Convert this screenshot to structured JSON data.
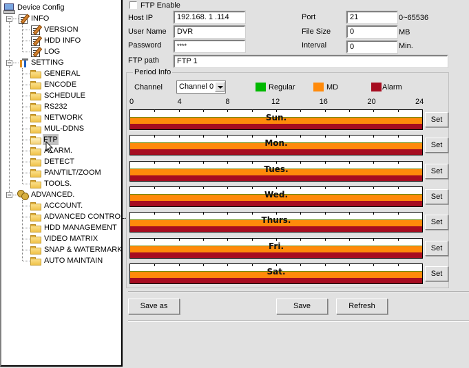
{
  "tree": {
    "root": {
      "label": "Device Config",
      "icon": "computer-icon"
    },
    "groups": [
      {
        "label": "INFO",
        "icon": "document-edit-icon",
        "expanded": true,
        "items": [
          {
            "label": "VERSION",
            "icon": "document-edit-icon"
          },
          {
            "label": "HDD INFO",
            "icon": "document-edit-icon"
          },
          {
            "label": "LOG",
            "icon": "document-edit-icon"
          }
        ]
      },
      {
        "label": "SETTING",
        "icon": "tools-icon",
        "expanded": true,
        "items": [
          {
            "label": "GENERAL",
            "icon": "folder-icon"
          },
          {
            "label": "ENCODE",
            "icon": "folder-icon"
          },
          {
            "label": "SCHEDULE",
            "icon": "folder-icon"
          },
          {
            "label": "RS232",
            "icon": "folder-icon"
          },
          {
            "label": "NETWORK",
            "icon": "folder-icon"
          },
          {
            "label": "MUL-DDNS",
            "icon": "folder-icon"
          },
          {
            "label": "FTP",
            "icon": "folder-open-icon",
            "selected": true
          },
          {
            "label": "ALARM.",
            "icon": "folder-icon"
          },
          {
            "label": "DETECT",
            "icon": "folder-icon"
          },
          {
            "label": "PAN/TILT/ZOOM",
            "icon": "folder-icon"
          },
          {
            "label": "TOOLS.",
            "icon": "folder-icon"
          }
        ]
      },
      {
        "label": "ADVANCED.",
        "icon": "gears-icon",
        "expanded": true,
        "items": [
          {
            "label": "ACCOUNT.",
            "icon": "folder-icon"
          },
          {
            "label": "ADVANCED CONTROL.",
            "icon": "folder-icon"
          },
          {
            "label": "HDD MANAGEMENT",
            "icon": "folder-icon"
          },
          {
            "label": "VIDEO MATRIX",
            "icon": "folder-icon"
          },
          {
            "label": "SNAP & WATERMARK",
            "icon": "folder-icon"
          },
          {
            "label": "AUTO MAINTAIN",
            "icon": "folder-icon"
          }
        ]
      }
    ]
  },
  "ftp": {
    "enable_label": "FTP Enable",
    "enable_checked": false,
    "host_ip_label": "Host IP",
    "host_ip_value": "192.168.  1 .114",
    "user_name_label": "User Name",
    "user_name_value": "DVR",
    "password_label": "Password",
    "password_value": "****",
    "ftp_path_label": "FTP path",
    "ftp_path_value": "FTP 1",
    "port_label": "Port",
    "port_value": "21",
    "port_range": "0~65536",
    "file_size_label": "File Size",
    "file_size_value": "0",
    "file_size_unit": "MB",
    "interval_label": "Interval",
    "interval_value": "0",
    "interval_unit": "Min."
  },
  "period": {
    "title": "Period Info",
    "channel_label": "Channel",
    "channel_selected": "Channel  0",
    "legend": [
      {
        "label": "Regular",
        "color": "#00b800"
      },
      {
        "label": "MD",
        "color": "#ff8a0a"
      },
      {
        "label": "Alarm",
        "color": "#a60c20"
      }
    ],
    "hour_ticks": [
      "0",
      "4",
      "8",
      "12",
      "16",
      "20",
      "24"
    ],
    "days": [
      {
        "name": "Sun.",
        "set_label": "Set"
      },
      {
        "name": "Mon.",
        "set_label": "Set"
      },
      {
        "name": "Tues.",
        "set_label": "Set"
      },
      {
        "name": "Wed.",
        "set_label": "Set"
      },
      {
        "name": "Thurs.",
        "set_label": "Set"
      },
      {
        "name": "Fri.",
        "set_label": "Set"
      },
      {
        "name": "Sat.",
        "set_label": "Set"
      }
    ]
  },
  "buttons": {
    "save_as": "Save as",
    "save": "Save",
    "refresh": "Refresh"
  }
}
